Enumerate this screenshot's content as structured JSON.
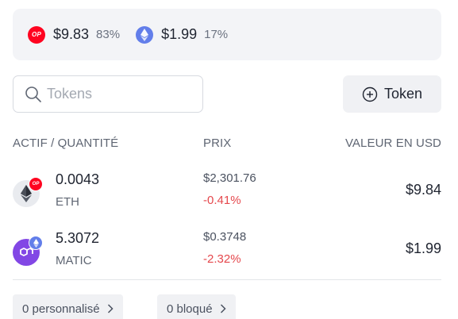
{
  "summary": {
    "chains": [
      {
        "icon": "optimism-logo-icon",
        "icon_text": "OP",
        "value": "$9.83",
        "percent": "83%",
        "color": "#ff0420"
      },
      {
        "icon": "ethereum-logo-icon",
        "value": "$1.99",
        "percent": "17%",
        "color": "#627eea"
      }
    ]
  },
  "search": {
    "placeholder": "Tokens",
    "icon": "search-icon"
  },
  "add_token": {
    "label": "Token",
    "icon": "plus-circle-icon"
  },
  "table": {
    "headers": {
      "asset": "ACTIF / QUANTITÉ",
      "price": "PRIX",
      "value": "VALEUR EN USD"
    },
    "rows": [
      {
        "quantity": "0.0043",
        "symbol": "ETH",
        "price": "$2,301.76",
        "change": "-0.41%",
        "value": "$9.84",
        "token_icon": "ethereum-logo-icon",
        "chain_badge": "optimism-logo-icon",
        "badge_text": "OP"
      },
      {
        "quantity": "5.3072",
        "symbol": "MATIC",
        "price": "$0.3748",
        "change": "-2.32%",
        "value": "$1.99",
        "token_icon": "polygon-logo-icon",
        "chain_badge": "ethereum-logo-icon"
      }
    ]
  },
  "footer": {
    "custom": "0 personnalisé",
    "blocked": "0 bloqué"
  },
  "colors": {
    "negative": "#e5484d",
    "optimism": "#ff0420",
    "ethereum": "#627eea",
    "polygon": "#8247e5"
  }
}
